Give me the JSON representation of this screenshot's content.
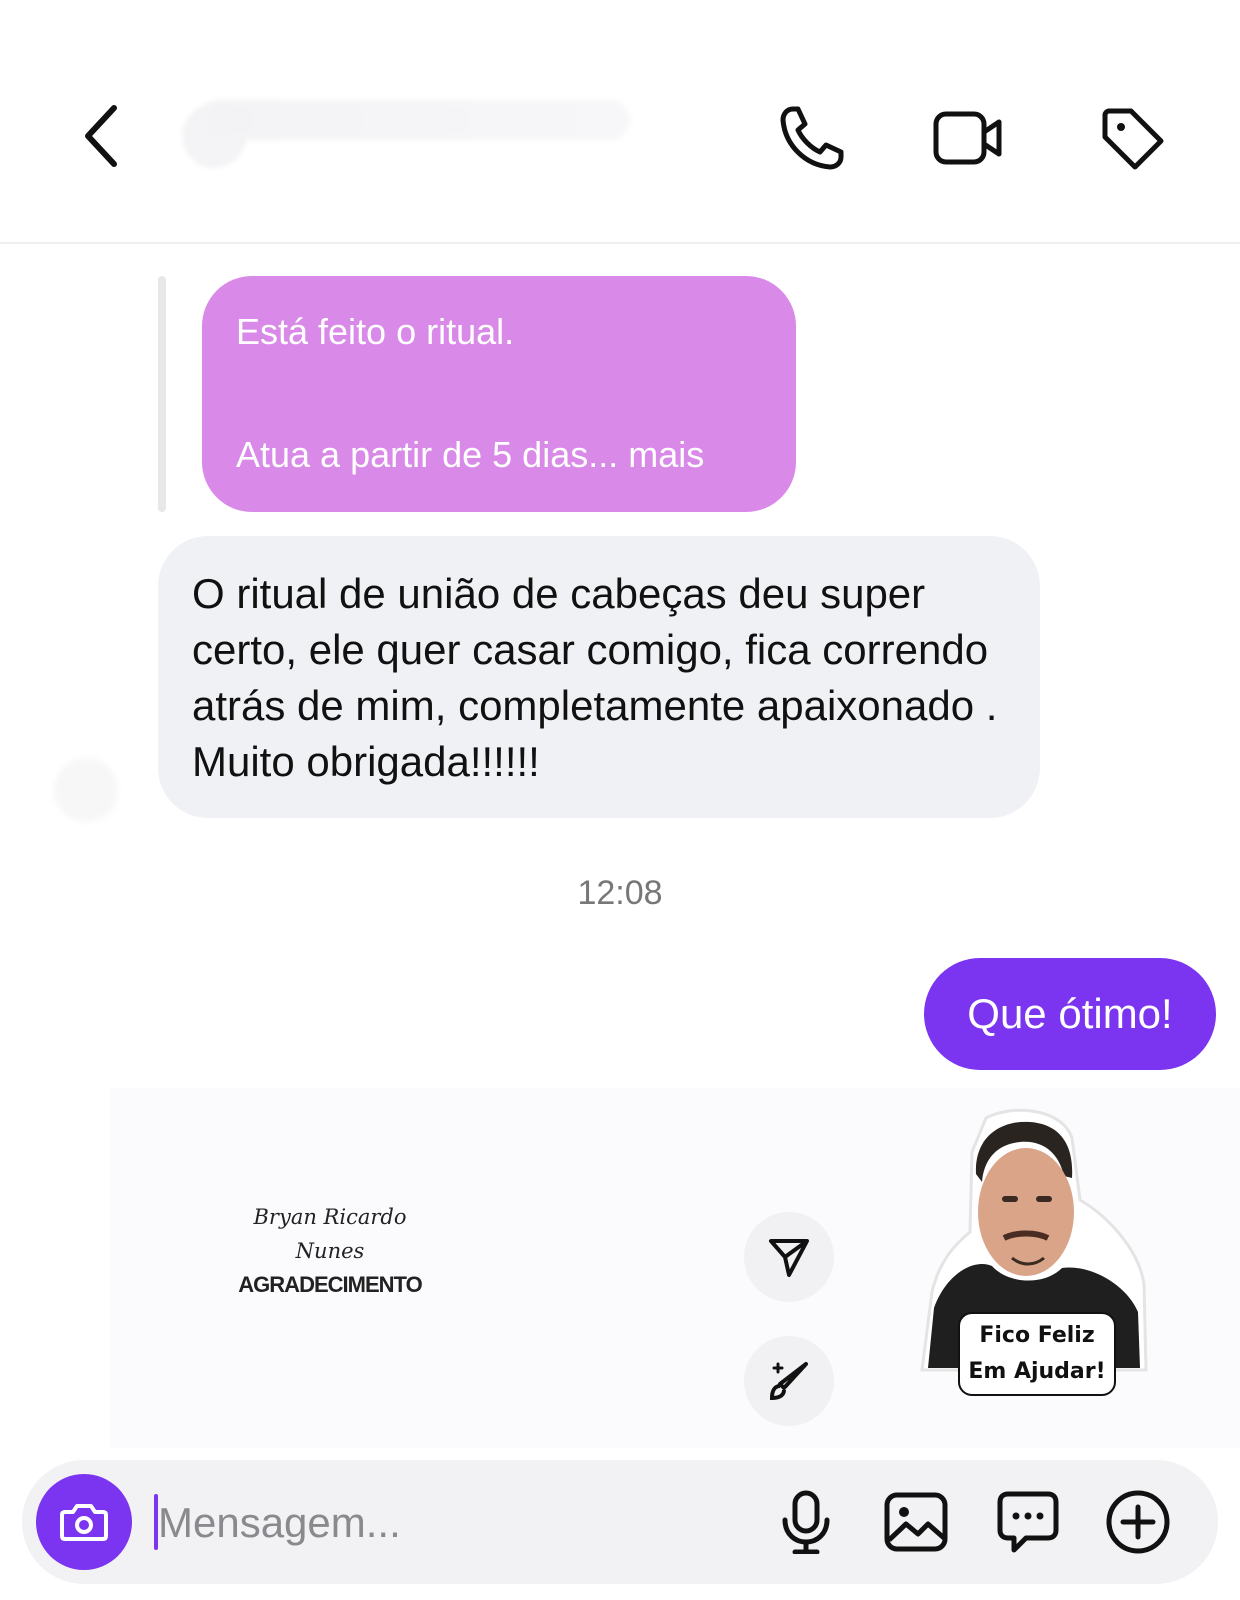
{
  "header": {
    "back_icon": "chevron-left-icon",
    "icons": [
      "phone-icon",
      "video-camera-icon",
      "tag-icon"
    ]
  },
  "reply_preview": {
    "line1": "Está feito o ritual.",
    "line2": "Atua a partir de 5 dias... mais"
  },
  "messages": {
    "incoming": "O ritual de união de cabeças deu super certo, ele quer casar comigo, fica correndo atrás de mim, completamente apaixonado . Muito obrigada!!!!!!",
    "timestamp": "12:08",
    "outgoing": "Que ótimo!"
  },
  "media": {
    "signature_line1": "Bryan Ricardo",
    "signature_line2": "Nunes",
    "caption": "AGRADECIMENTO",
    "sticker_text_line1": "Fico Feliz",
    "sticker_text_line2": "Em Ajudar!"
  },
  "composer": {
    "placeholder": "Mensagem...",
    "icons": [
      "camera-icon",
      "microphone-icon",
      "gallery-icon",
      "sticker-chat-icon",
      "plus-circle-icon"
    ]
  },
  "colors": {
    "accent": "#7b34f0",
    "reply_bubble": "#d98ae8",
    "incoming_bubble": "#f0f1f4"
  }
}
